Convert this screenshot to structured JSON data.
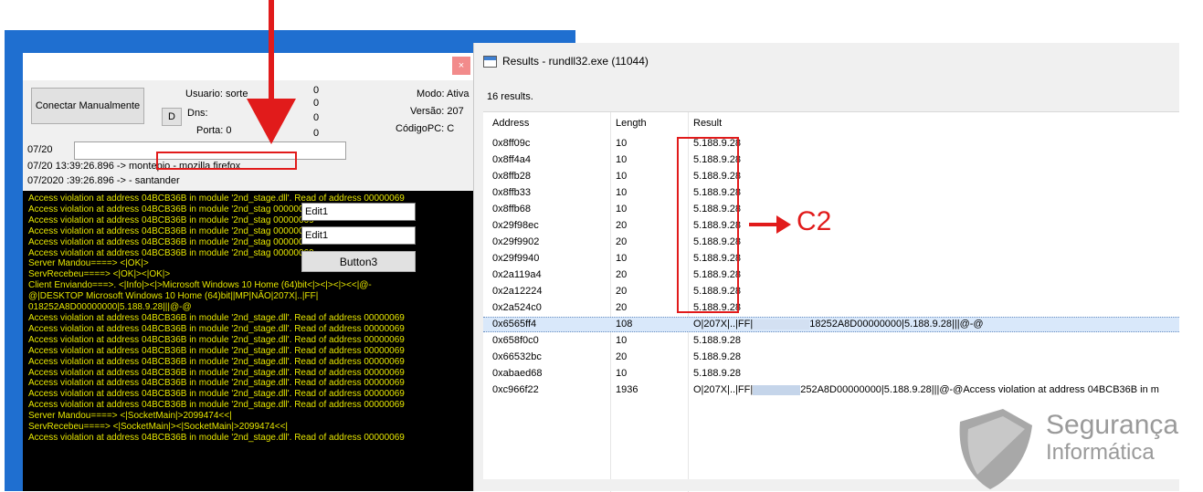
{
  "left_window": {
    "connect_button": "Conectar Manualmente",
    "d_button": "D",
    "usuario_label": "Usuario:",
    "usuario_value": "sorte",
    "dns_label": "Dns:",
    "porta_label": "Porta: 0",
    "counters": [
      "0",
      "0",
      "0",
      "0"
    ],
    "modo_label": "Modo: Ativa",
    "versao_label": "Versão: 207",
    "codigo_label": "CódigoPC: C",
    "close_glyph": "×",
    "log_lines": [
      "07/20",
      "07/20 13:39:26.896 -> montepio - mozilla firefox",
      "07/2020 :39:26.896 -> - santander"
    ]
  },
  "console": {
    "lines": [
      "Access violation at address 04BCB36B in module '2nd_stage.dll'. Read of address 00000069",
      "Access violation at address 04BCB36B in module '2nd_stag                      00000069",
      "Access violation at address 04BCB36B in module '2nd_stag                      00000069",
      "Access violation at address 04BCB36B in module '2nd_stag                      00000069",
      "Access violation at address 04BCB36B in module '2nd_stag                      00000069",
      "Access violation at address 04BCB36B in module '2nd_stag                      00000069",
      "Server Mandou====> <|OK|>",
      "ServRecebeu====> <|OK|><|OK|>",
      "Client Enviando===>. <|Info|><|>Microsoft Windows 10 Home (64)bit<|><|><|><<|@-",
      "@|DESKTOP                Microsoft Windows 10 Home (64)bit||MP|NÃO|207X|..|FF|",
      "           018252A8D00000000|5.188.9.28|||@-@",
      "Access violation at address 04BCB36B in module '2nd_stage.dll'. Read of address 00000069",
      "Access violation at address 04BCB36B in module '2nd_stage.dll'. Read of address 00000069",
      "Access violation at address 04BCB36B in module '2nd_stage.dll'. Read of address 00000069",
      "Access violation at address 04BCB36B in module '2nd_stage.dll'. Read of address 00000069",
      "Access violation at address 04BCB36B in module '2nd_stage.dll'. Read of address 00000069",
      "Access violation at address 04BCB36B in module '2nd_stage.dll'. Read of address 00000069",
      "Access violation at address 04BCB36B in module '2nd_stage.dll'. Read of address 00000069",
      "Access violation at address 04BCB36B in module '2nd_stage.dll'. Read of address 00000069",
      "Access violation at address 04BCB36B in module '2nd_stage.dll'. Read of address 00000069",
      "Server Mandou====> <|SocketMain|>2099474<<|",
      "ServRecebeu====> <|SocketMain|><|SocketMain|>2099474<<|",
      "Access violation at address 04BCB36B in module '2nd_stage.dll'. Read of address 00000069"
    ],
    "edit1_a": "Edit1",
    "edit1_b": "Edit1",
    "button3": "Button3"
  },
  "results_window": {
    "title": "Results - rundll32.exe (11044)",
    "count": "16 results.",
    "headers": [
      "Address",
      "Length",
      "Result"
    ],
    "rows": [
      {
        "address": "0x8ff09c",
        "length": "10",
        "result": "5.188.9.28"
      },
      {
        "address": "0x8ff4a4",
        "length": "10",
        "result": "5.188.9.28"
      },
      {
        "address": "0x8ffb28",
        "length": "10",
        "result": "5.188.9.28"
      },
      {
        "address": "0x8ffb33",
        "length": "10",
        "result": "5.188.9.28"
      },
      {
        "address": "0x8ffb68",
        "length": "10",
        "result": "5.188.9.28"
      },
      {
        "address": "0x29f98ec",
        "length": "20",
        "result": "5.188.9.28"
      },
      {
        "address": "0x29f9902",
        "length": "20",
        "result": "5.188.9.28"
      },
      {
        "address": "0x29f9940",
        "length": "10",
        "result": "5.188.9.28"
      },
      {
        "address": "0x2a119a4",
        "length": "20",
        "result": "5.188.9.28"
      },
      {
        "address": "0x2a12224",
        "length": "20",
        "result": "5.188.9.28"
      },
      {
        "address": "0x2a524c0",
        "length": "20",
        "result": "5.188.9.28"
      },
      {
        "address": "0x6565ff4",
        "length": "108",
        "result_pre": "O|207X|..|FF|",
        "result_post": "18252A8D00000000|5.188.9.28|||@-@",
        "selected": true
      },
      {
        "address": "0x658f0c0",
        "length": "10",
        "result": "5.188.9.28"
      },
      {
        "address": "0x66532bc",
        "length": "20",
        "result": "5.188.9.28"
      },
      {
        "address": "0xabaed68",
        "length": "10",
        "result": "5.188.9.28"
      },
      {
        "address": "0xc966f22",
        "length": "1936",
        "result_pre": "O|207X|..|FF|",
        "result_post": "252A8D00000000|5.188.9.28|||@-@Access violation at address 04BCB36B in m"
      }
    ]
  },
  "annotations": {
    "c2_label": "C2",
    "accent_red": "#e11b1b"
  },
  "logo": {
    "line1": "Segurança",
    "line2": "Informática"
  }
}
